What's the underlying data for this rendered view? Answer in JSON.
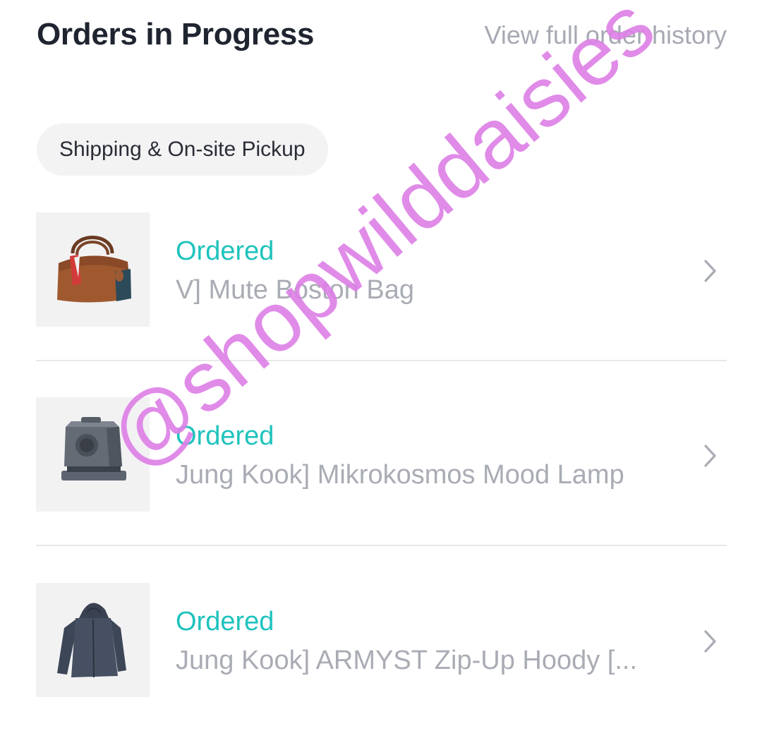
{
  "header": {
    "title": "Orders in Progress",
    "history_link": "View full order history"
  },
  "filter": {
    "chip_label": "Shipping & On-site Pickup"
  },
  "orders": [
    {
      "status": "Ordered",
      "name": "V] Mute Boston Bag",
      "thumbnail": "boston-bag-image"
    },
    {
      "status": "Ordered",
      "name": "Jung Kook] Mikrokosmos Mood Lamp",
      "thumbnail": "mood-lamp-image"
    },
    {
      "status": "Ordered",
      "name": "Jung Kook] ARMYST Zip-Up Hoody [...",
      "thumbnail": "zip-up-hoody-image"
    }
  ],
  "watermark": {
    "text": "@shopwilddaisies"
  },
  "colors": {
    "status": "#1fc3bd",
    "title": "#1f2430",
    "muted": "#a9acb4",
    "chip_bg": "#f3f3f4",
    "watermark": "#dd7fe6"
  },
  "icons": {
    "row_chevron": "chevron-right-icon"
  }
}
